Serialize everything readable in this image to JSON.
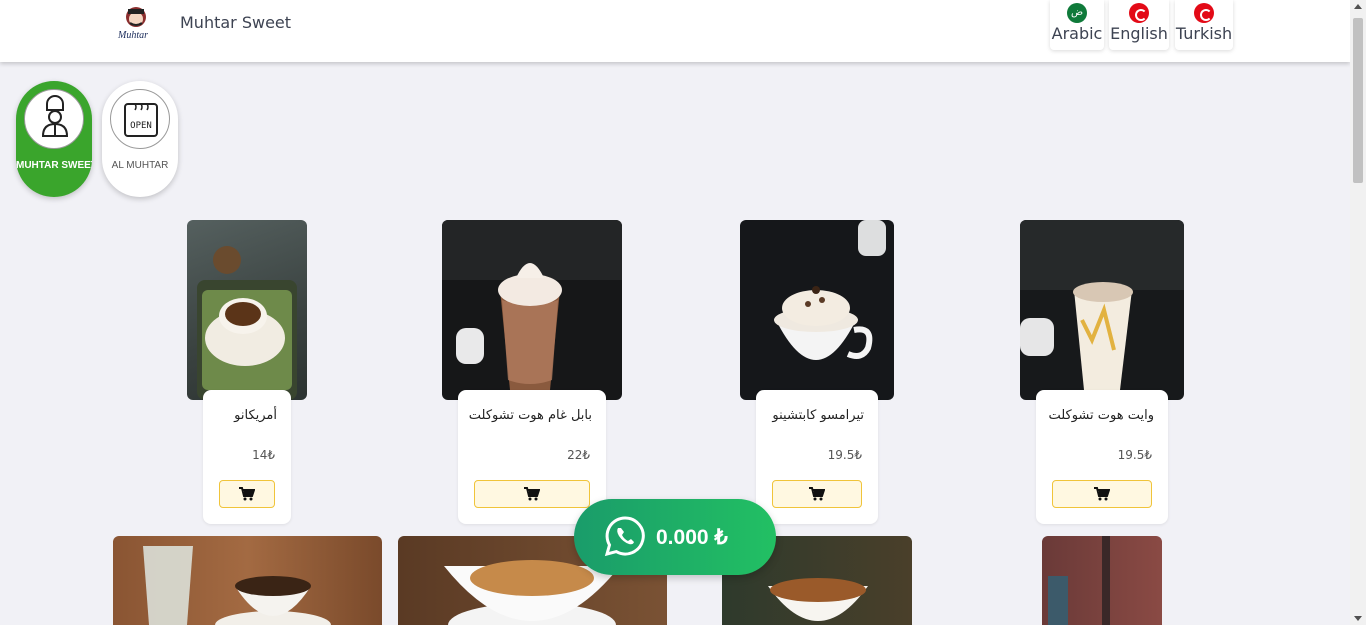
{
  "header": {
    "brand": "Muhtar Sweet",
    "languages": [
      {
        "label": "Arabic",
        "flag": "saudi-flag-icon"
      },
      {
        "label": "English",
        "flag": "turkey-flag-icon"
      },
      {
        "label": "Turkish",
        "flag": "turkey-flag-icon"
      }
    ]
  },
  "categories": [
    {
      "label": "MUHTAR SWEET",
      "icon": "chef-icon",
      "active": true
    },
    {
      "label": "AL MUHTAR",
      "icon": "open-cafe-icon",
      "active": false
    }
  ],
  "products": [
    {
      "name": "أمريكانو",
      "price": "14₺"
    },
    {
      "name": "بابل غام هوت تشوكلت",
      "price": "22₺"
    },
    {
      "name": "تيرامسو كابتشينو",
      "price": "19.5₺"
    },
    {
      "name": "وايت هوت تشوكلت",
      "price": "19.5₺"
    }
  ],
  "cart": {
    "total": "0.000 ₺"
  },
  "colors": {
    "accent_green": "#3aa52c",
    "whatsapp_green": "#22c063",
    "cart_button_border": "#f0c43a"
  }
}
